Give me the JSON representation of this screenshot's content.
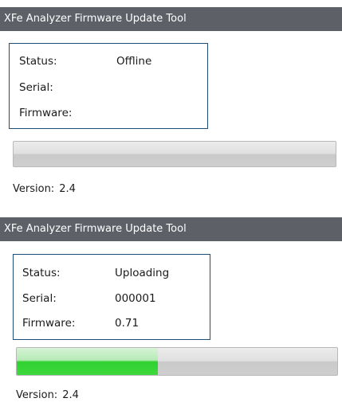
{
  "windows": [
    {
      "title": "XFe Analyzer Firmware Update Tool",
      "status_label": "Status:",
      "status_value": "Offline",
      "serial_label": "Serial:",
      "serial_value": "",
      "firmware_label": "Firmware:",
      "firmware_value": "",
      "progress_fraction": 0,
      "version_label": "Version:",
      "version_value": "2.4"
    },
    {
      "title": "XFe Analyzer Firmware Update Tool",
      "status_label": "Status:",
      "status_value": "Uploading",
      "serial_label": "Serial:",
      "serial_value": "000001",
      "firmware_label": "Firmware:",
      "firmware_value": "0.71",
      "progress_fraction": 0.44,
      "version_label": "Version:",
      "version_value": "2.4"
    }
  ],
  "colors": {
    "titlebar": "#5e6068",
    "box_border": "#1f4e79",
    "progress_fill": "#2fd12f"
  }
}
